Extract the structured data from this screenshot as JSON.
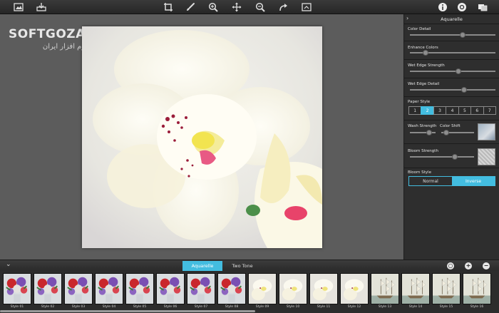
{
  "watermark": {
    "title": "SOFTGOZAR.COM",
    "subtitle": "اولین دانشنامه نرم افزار ایران"
  },
  "toolbar": {
    "left_icons": [
      "image-open-icon",
      "export-icon"
    ],
    "center_icons": [
      "crop-icon",
      "brush-icon",
      "zoom-in-icon",
      "move-icon",
      "zoom-out-icon",
      "redo-icon",
      "compare-icon"
    ],
    "right_icons": [
      "info-icon",
      "settings-icon",
      "share-icon"
    ]
  },
  "panel": {
    "title": "Aquarelle",
    "color_detail": {
      "label": "Color Detail",
      "value": 0.78
    },
    "enhance_colors": {
      "label": "Enhance Colors",
      "value": 0.2
    },
    "wet_edge_strength": {
      "label": "Wet Edge Strength",
      "value": 0.6
    },
    "wet_edge_detail": {
      "label": "Wet Edge Detail",
      "value": 0.65
    },
    "paper_style": {
      "label": "Paper Style",
      "options": [
        "1",
        "2",
        "3",
        "4",
        "5",
        "6",
        "7"
      ],
      "selected": "2"
    },
    "wash_strength": {
      "label": "Wash Strength",
      "value": 0.35
    },
    "color_shift": {
      "label": "Color Shift",
      "value": 0.4
    },
    "bloom_strength": {
      "label": "Bloom Strength",
      "value": 0.7
    },
    "bloom_style": {
      "label": "Bloom Style",
      "options": [
        "Normal",
        "Inverse"
      ],
      "selected": "Inverse"
    }
  },
  "bottombar": {
    "tabs": [
      "Aquarelle",
      "Two Tone"
    ],
    "active_tab": "Aquarelle"
  },
  "presets": [
    {
      "label": "Style 01",
      "kind": "bouquet"
    },
    {
      "label": "Style 02",
      "kind": "bouquet"
    },
    {
      "label": "Style 03",
      "kind": "bouquet"
    },
    {
      "label": "Style 04",
      "kind": "bouquet"
    },
    {
      "label": "Style 05",
      "kind": "bouquet"
    },
    {
      "label": "Style 06",
      "kind": "bouquet"
    },
    {
      "label": "Style 07",
      "kind": "bouquet"
    },
    {
      "label": "Style 08",
      "kind": "bouquet"
    },
    {
      "label": "Style 09",
      "kind": "orchid"
    },
    {
      "label": "Style 10",
      "kind": "orchid"
    },
    {
      "label": "Style 11",
      "kind": "orchid"
    },
    {
      "label": "Style 12",
      "kind": "orchid"
    },
    {
      "label": "Style 13",
      "kind": "ship"
    },
    {
      "label": "Style 14",
      "kind": "ship"
    },
    {
      "label": "Style 15",
      "kind": "ship"
    },
    {
      "label": "Style 16",
      "kind": "ship"
    }
  ],
  "colors": {
    "accent": "#43bde0",
    "panel": "#2e2e2e",
    "canvas": "#5c5c5c"
  }
}
